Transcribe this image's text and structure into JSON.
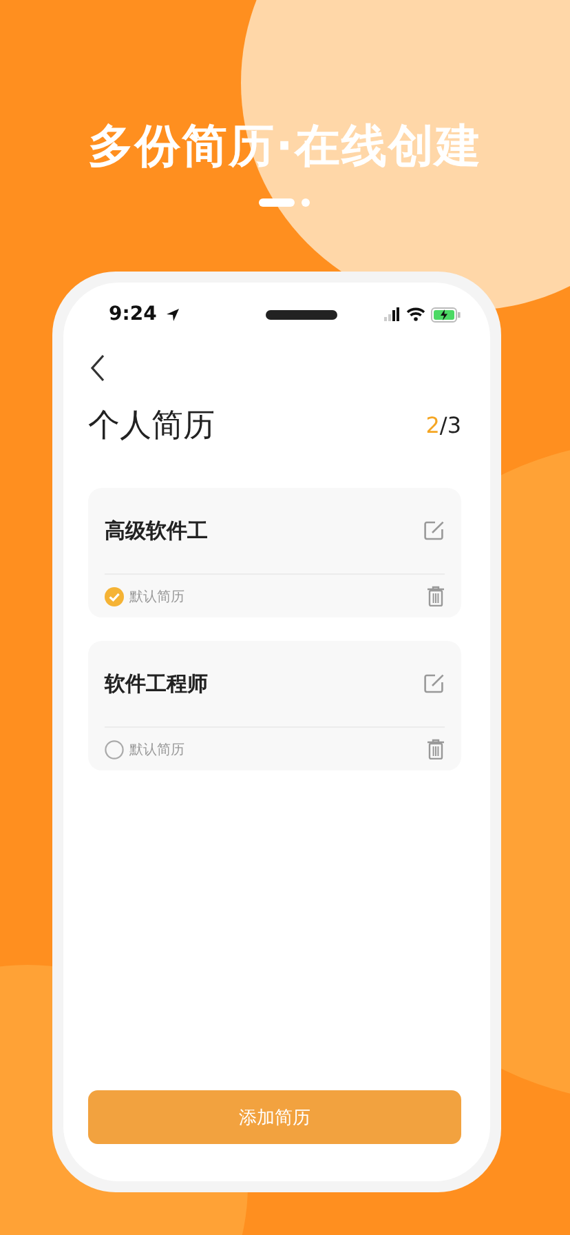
{
  "headline": "多份简历·在线创建",
  "status_bar": {
    "time": "9:24"
  },
  "page": {
    "title": "个人简历",
    "counter_current": "2",
    "counter_total": "/3"
  },
  "resumes": [
    {
      "title": "高级软件工",
      "default_label": "默认简历",
      "selected": true
    },
    {
      "title": "软件工程师",
      "default_label": "默认简历",
      "selected": false
    }
  ],
  "add_button": "添加简历"
}
